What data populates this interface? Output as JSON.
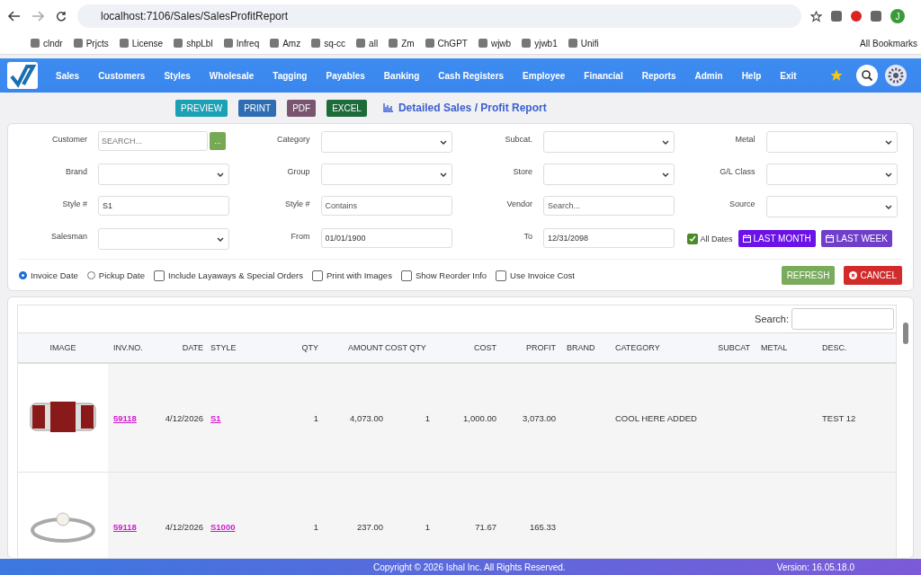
{
  "browser": {
    "url": "localhost:7106/Sales/SalesProfitReport",
    "profile_initial": "J"
  },
  "bookmarks": [
    "clndr",
    "Prjcts",
    "License",
    "shpLbl",
    "Infreq",
    "Amz",
    "sq-cc",
    "all",
    "Zm",
    "ChGPT",
    "wjwb",
    "yjwb1",
    "Unifi"
  ],
  "bookmarks_all": "All Bookmarks",
  "nav": {
    "items": [
      "Sales",
      "Customers",
      "Styles",
      "Wholesale",
      "Tagging",
      "Payables",
      "Banking",
      "Cash Registers",
      "Employee",
      "Financial",
      "Reports",
      "Admin",
      "Help",
      "Exit"
    ]
  },
  "toolbar": {
    "buttons": [
      {
        "label": "PREVIEW",
        "kind": "preview"
      },
      {
        "label": "PRINT",
        "kind": "print"
      },
      {
        "label": "PDF",
        "kind": "pdf"
      },
      {
        "label": "EXCEL",
        "kind": "excel"
      }
    ],
    "title": "Detailed Sales / Profit Report"
  },
  "filters": [
    {
      "label": "Customer",
      "kind": "search",
      "placeholder": "SEARCH...",
      "button": "..."
    },
    {
      "label": "Category",
      "kind": "select"
    },
    {
      "label": "Subcat.",
      "kind": "select"
    },
    {
      "label": "Metal",
      "kind": "select"
    },
    {
      "label": "Brand",
      "kind": "select"
    },
    {
      "label": "Group",
      "kind": "select"
    },
    {
      "label": "Store",
      "kind": "select"
    },
    {
      "label": "G/L Class",
      "kind": "select"
    },
    {
      "label": "Style #",
      "kind": "input",
      "value": "S1"
    },
    {
      "label": "Style #",
      "kind": "input",
      "placeholder": "Contains"
    },
    {
      "label": "Vendor",
      "kind": "input",
      "placeholder": "Search..."
    },
    {
      "label": "Source",
      "kind": "select"
    },
    {
      "label": "Salesman",
      "kind": "select"
    },
    {
      "label": "From",
      "kind": "input",
      "value": "01/01/1900"
    },
    {
      "label": "To",
      "kind": "input",
      "value": "12/31/2098"
    },
    {
      "label": "All Dates",
      "kind": "dates",
      "checked": true,
      "buttons": [
        "LAST MONTH",
        "LAST WEEK"
      ]
    }
  ],
  "options": [
    {
      "label": "Invoice Date",
      "kind": "radio",
      "selected": true
    },
    {
      "label": "Pickup Date",
      "kind": "radio",
      "selected": false
    },
    {
      "label": "Include Layaways & Special Orders",
      "kind": "checkbox",
      "checked": false
    },
    {
      "label": "Print with Images",
      "kind": "checkbox",
      "checked": false
    },
    {
      "label": "Show Reorder Info",
      "kind": "checkbox",
      "checked": false
    },
    {
      "label": "Use Invoice Cost",
      "kind": "checkbox",
      "checked": false
    }
  ],
  "actions": [
    "REFRESH",
    "CANCEL"
  ],
  "table": {
    "search_label": "Search:",
    "columns": [
      "IMAGE",
      "INV.NO.",
      "DATE",
      "STYLE",
      "QTY",
      "AMOUNT",
      "COST QTY",
      "COST",
      "PROFIT",
      "BRAND",
      "CATEGORY",
      "SUBCAT",
      "METAL",
      "DESC."
    ],
    "rows": [
      {
        "inv": "59118",
        "date": "4/12/2026",
        "style": "S1",
        "qty": "1",
        "amount": "4,073.00",
        "cost_qty": "1",
        "cost": "1,000.00",
        "profit": "3,073.00",
        "category": "COOL HERE ADDED",
        "desc": "TEST 12"
      },
      {
        "inv": "59118",
        "date": "4/12/2026",
        "style": "S1000",
        "qty": "1",
        "amount": "237.00",
        "cost_qty": "1",
        "cost": "71.67",
        "profit": "165.33",
        "category": "",
        "desc": ""
      }
    ]
  },
  "footer": {
    "copyright": "Copyright © 2026 Ishal Inc. All Rights Reserved.",
    "version": "Version: 16.05.18.0"
  }
}
